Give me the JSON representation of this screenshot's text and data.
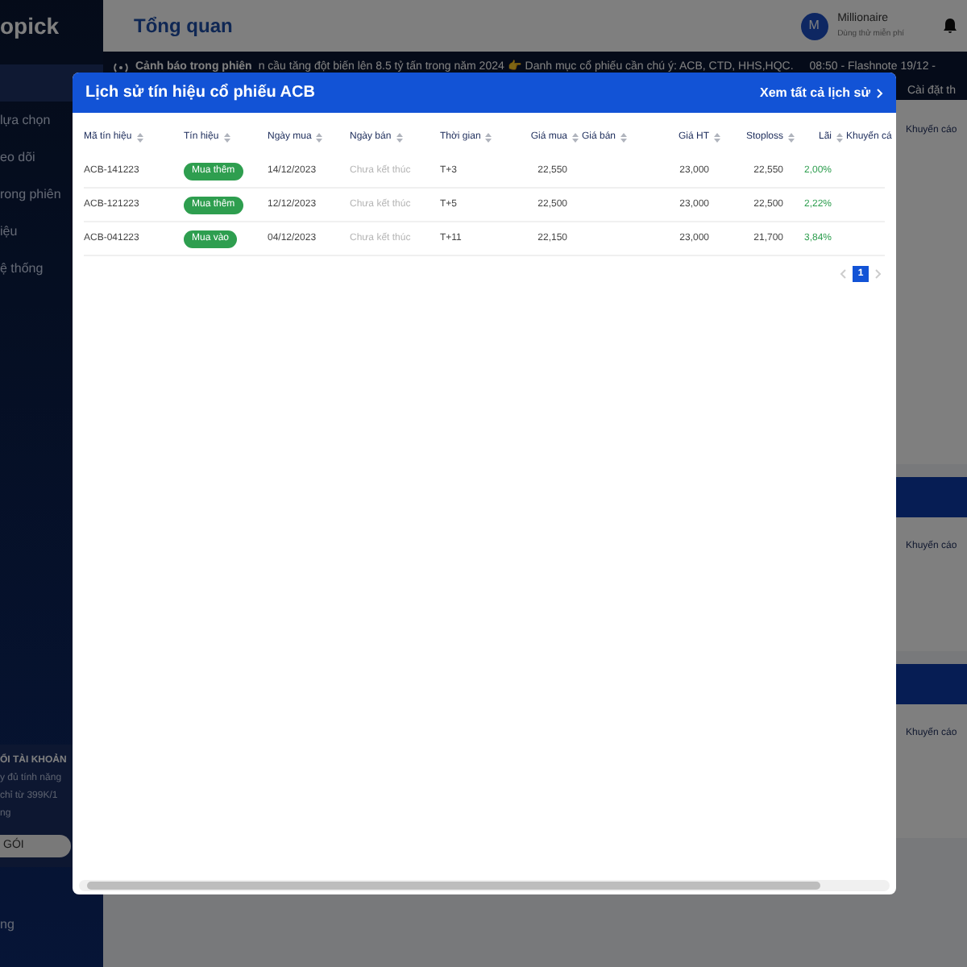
{
  "sidebar": {
    "logo": "opick",
    "items": [
      {
        "selected": true
      },
      {
        "label": "lựa chọn",
        "selected": false
      },
      {
        "label": "eo dõi",
        "selected": false
      },
      {
        "label": "rong phiên",
        "selected": false
      },
      {
        "label": "iệu",
        "selected": false
      },
      {
        "label": "ệ thống",
        "selected": false
      }
    ],
    "promo": {
      "title": "ỔI TÀI KHOẢN",
      "lines": [
        "y đủ tính năng",
        "chỉ từ 399K/1",
        "ng"
      ],
      "button": "GÓI"
    },
    "footer": "ng"
  },
  "header": {
    "title": "Tổng quan",
    "user": {
      "initial": "M",
      "name": "Millionaire",
      "plan": "Dùng thử miễn phí"
    }
  },
  "ticker": {
    "label": "Cảnh báo trong phiên",
    "text": "n cầu tăng đột biến lên 8.5 tỷ tấn trong năm 2024 👉 Danh mục cổ phiếu cần chú ý: ACB, CTD, HHS,HQC.",
    "text_2": "08:50 - Flashnote 19/12 -",
    "settings": "Cài đặt th"
  },
  "background": {
    "table_header": "Khuyến cáo",
    "cards": [
      {
        "label": "Khuyến cáo"
      },
      {
        "label": "Khuyến cáo"
      }
    ]
  },
  "modal": {
    "title": "Lịch sử tín hiệu cổ phiếu ACB",
    "link": "Xem tất cả lịch sử",
    "columns": [
      "Mã tín hiệu",
      "Tín hiệu",
      "Ngày mua",
      "Ngày bán",
      "Thời gian",
      "Giá mua",
      "Giá bán",
      "Giá HT",
      "Stoploss",
      "Lãi",
      "Khuyến cá"
    ],
    "rows": [
      {
        "code": "ACB-141223",
        "signal": {
          "label": "Mua thêm",
          "color": "#2e9e4f"
        },
        "buy_date": "14/12/2023",
        "sell_date": "Chưa kết thúc",
        "duration": "T+3",
        "buy_price": "22,550",
        "current_price": "23,000",
        "stoploss": "22,550",
        "profit": "2,00%"
      },
      {
        "code": "ACB-121223",
        "signal": {
          "label": "Mua thêm",
          "color": "#2e9e4f"
        },
        "buy_date": "12/12/2023",
        "sell_date": "Chưa kết thúc",
        "duration": "T+5",
        "buy_price": "22,500",
        "current_price": "23,000",
        "stoploss": "22,500",
        "profit": "2,22%"
      },
      {
        "code": "ACB-041223",
        "signal": {
          "label": "Mua vào",
          "color": "#2e9e4f"
        },
        "buy_date": "04/12/2023",
        "sell_date": "Chưa kết thúc",
        "duration": "T+11",
        "buy_price": "22,150",
        "current_price": "23,000",
        "stoploss": "21,700",
        "profit": "3,84%"
      }
    ],
    "pagination": [
      {
        "label": "1",
        "selected": true
      }
    ]
  }
}
